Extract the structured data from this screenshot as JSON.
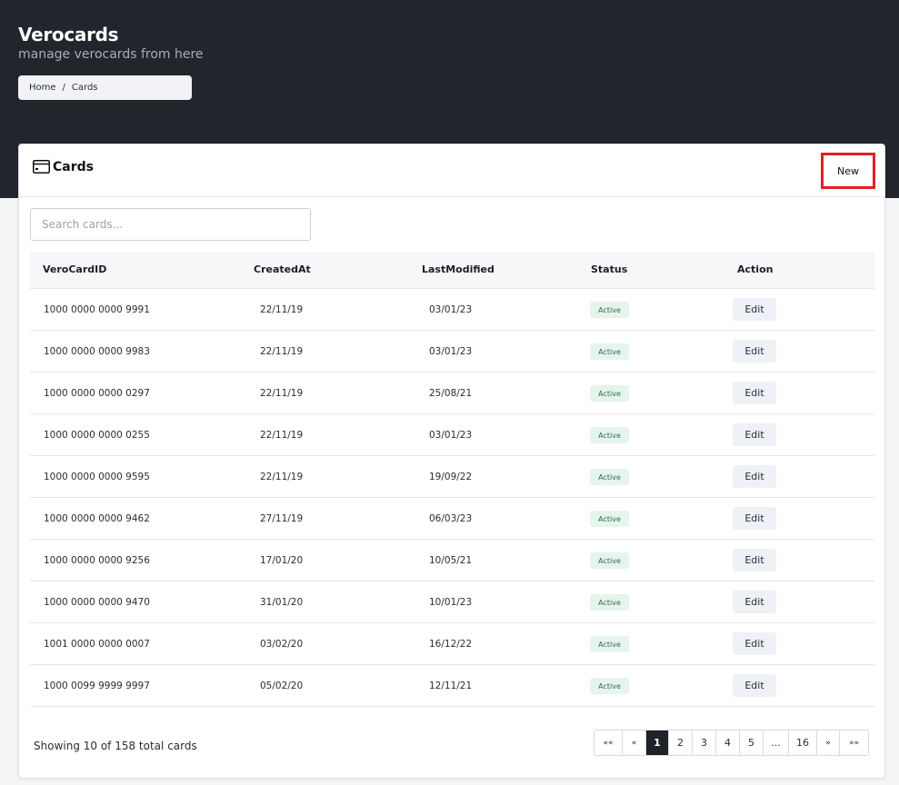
{
  "app": {
    "title": "Verocards",
    "subtitle": "manage verocards from here"
  },
  "breadcrumb": {
    "home": "Home",
    "separator": "/",
    "current": "Cards"
  },
  "card": {
    "title": "Cards",
    "icon": "credit-card-icon",
    "new_label": "New"
  },
  "search": {
    "value": "",
    "placeholder": "Search cards..."
  },
  "table": {
    "headers": [
      "VeroCardID",
      "CreatedAt",
      "LastModified",
      "Status",
      "Action"
    ],
    "rows": [
      {
        "id": "1000 0000 0000 9991",
        "created": "22/11/19",
        "modified": "03/01/23",
        "status": "Active",
        "action": "Edit"
      },
      {
        "id": "1000 0000 0000 9983",
        "created": "22/11/19",
        "modified": "03/01/23",
        "status": "Active",
        "action": "Edit"
      },
      {
        "id": "1000 0000 0000 0297",
        "created": "22/11/19",
        "modified": "25/08/21",
        "status": "Active",
        "action": "Edit"
      },
      {
        "id": "1000 0000 0000 0255",
        "created": "22/11/19",
        "modified": "03/01/23",
        "status": "Active",
        "action": "Edit"
      },
      {
        "id": "1000 0000 0000 9595",
        "created": "22/11/19",
        "modified": "19/09/22",
        "status": "Active",
        "action": "Edit"
      },
      {
        "id": "1000 0000 0000 9462",
        "created": "27/11/19",
        "modified": "06/03/23",
        "status": "Active",
        "action": "Edit"
      },
      {
        "id": "1000 0000 0000 9256",
        "created": "17/01/20",
        "modified": "10/05/21",
        "status": "Active",
        "action": "Edit"
      },
      {
        "id": "1000 0000 0000 9470",
        "created": "31/01/20",
        "modified": "10/01/23",
        "status": "Active",
        "action": "Edit"
      },
      {
        "id": "1001 0000 0000 0007",
        "created": "03/02/20",
        "modified": "16/12/22",
        "status": "Active",
        "action": "Edit"
      },
      {
        "id": "1000 0099 9999 9997",
        "created": "05/02/20",
        "modified": "12/11/21",
        "status": "Active",
        "action": "Edit"
      }
    ]
  },
  "footer": {
    "summary": "Showing 10 of 158 total cards"
  },
  "pagination": {
    "items": [
      "««",
      "«",
      "1",
      "2",
      "3",
      "4",
      "5",
      "...",
      "16",
      "»",
      "»»"
    ],
    "active": "1"
  },
  "colors": {
    "header_bg": "#22252b",
    "highlight": "#e0202a",
    "badge_bg": "#e6f4ee",
    "badge_text": "#2f6b4c"
  }
}
